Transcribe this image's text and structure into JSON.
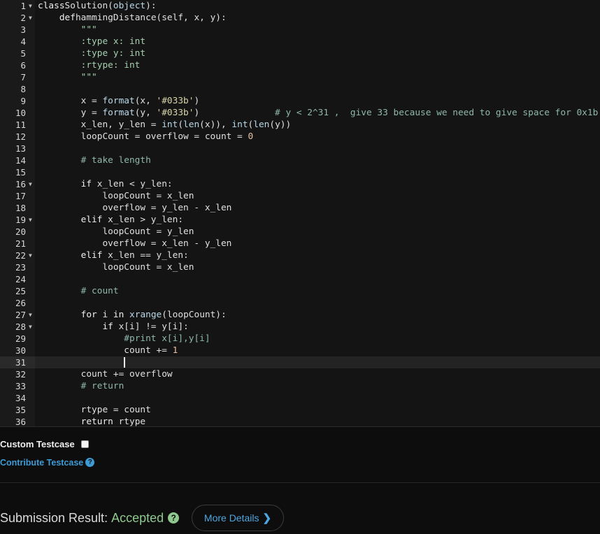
{
  "editor": {
    "active_line": 31,
    "lines": [
      {
        "n": "1",
        "fold": true,
        "tokens": [
          [
            "kw",
            "class"
          ],
          [
            "",
            "Solution("
          ],
          [
            "bi",
            "object"
          ],
          [
            "",
            "):"
          ]
        ]
      },
      {
        "n": "2",
        "fold": true,
        "tokens": [
          [
            "",
            "    "
          ],
          [
            "kw",
            "def"
          ],
          [
            "",
            "hammingDistance(self, x, y):"
          ]
        ]
      },
      {
        "n": "3",
        "fold": false,
        "tokens": [
          [
            "",
            "        "
          ],
          [
            "doc",
            "\"\"\""
          ]
        ]
      },
      {
        "n": "4",
        "fold": false,
        "tokens": [
          [
            "",
            "        "
          ],
          [
            "doc",
            ":type x: int"
          ]
        ]
      },
      {
        "n": "5",
        "fold": false,
        "tokens": [
          [
            "",
            "        "
          ],
          [
            "doc",
            ":type y: int"
          ]
        ]
      },
      {
        "n": "6",
        "fold": false,
        "tokens": [
          [
            "",
            "        "
          ],
          [
            "doc",
            ":rtype: int"
          ]
        ]
      },
      {
        "n": "7",
        "fold": false,
        "tokens": [
          [
            "",
            "        "
          ],
          [
            "doc",
            "\"\"\""
          ]
        ]
      },
      {
        "n": "8",
        "fold": false,
        "tokens": []
      },
      {
        "n": "9",
        "fold": false,
        "tokens": [
          [
            "",
            "        x = "
          ],
          [
            "bi",
            "format"
          ],
          [
            "",
            "(x, "
          ],
          [
            "str",
            "'#033b'"
          ],
          [
            "",
            ")"
          ]
        ]
      },
      {
        "n": "10",
        "fold": false,
        "tokens": [
          [
            "",
            "        y = "
          ],
          [
            "bi",
            "format"
          ],
          [
            "",
            "(y, "
          ],
          [
            "str",
            "'#033b'"
          ],
          [
            "",
            ")              "
          ],
          [
            "cm",
            "# y < 2^31 ,  give 33 because we need to give space for 0x1b"
          ]
        ]
      },
      {
        "n": "11",
        "fold": false,
        "tokens": [
          [
            "",
            "        x_len, y_len = "
          ],
          [
            "bi",
            "int"
          ],
          [
            "",
            "("
          ],
          [
            "bi",
            "len"
          ],
          [
            "",
            "(x)), "
          ],
          [
            "bi",
            "int"
          ],
          [
            "",
            "("
          ],
          [
            "bi",
            "len"
          ],
          [
            "",
            "(y))"
          ]
        ]
      },
      {
        "n": "12",
        "fold": false,
        "tokens": [
          [
            "",
            "        loopCount = overflow = count = "
          ],
          [
            "num",
            "0"
          ]
        ]
      },
      {
        "n": "13",
        "fold": false,
        "tokens": []
      },
      {
        "n": "14",
        "fold": false,
        "tokens": [
          [
            "",
            "        "
          ],
          [
            "cm",
            "# take length"
          ]
        ]
      },
      {
        "n": "15",
        "fold": false,
        "tokens": []
      },
      {
        "n": "16",
        "fold": true,
        "tokens": [
          [
            "",
            "        "
          ],
          [
            "kw",
            "if"
          ],
          [
            "",
            " x_len < y_len:"
          ]
        ]
      },
      {
        "n": "17",
        "fold": false,
        "tokens": [
          [
            "",
            "            loopCount = x_len"
          ]
        ]
      },
      {
        "n": "18",
        "fold": false,
        "tokens": [
          [
            "",
            "            overflow = y_len - x_len"
          ]
        ]
      },
      {
        "n": "19",
        "fold": true,
        "tokens": [
          [
            "",
            "        "
          ],
          [
            "kw",
            "elif"
          ],
          [
            "",
            " x_len > y_len:"
          ]
        ]
      },
      {
        "n": "20",
        "fold": false,
        "tokens": [
          [
            "",
            "            loopCount = y_len"
          ]
        ]
      },
      {
        "n": "21",
        "fold": false,
        "tokens": [
          [
            "",
            "            overflow = x_len - y_len"
          ]
        ]
      },
      {
        "n": "22",
        "fold": true,
        "tokens": [
          [
            "",
            "        "
          ],
          [
            "kw",
            "elif"
          ],
          [
            "",
            " x_len == y_len:"
          ]
        ]
      },
      {
        "n": "23",
        "fold": false,
        "tokens": [
          [
            "",
            "            loopCount = x_len"
          ]
        ]
      },
      {
        "n": "24",
        "fold": false,
        "tokens": []
      },
      {
        "n": "25",
        "fold": false,
        "tokens": [
          [
            "",
            "        "
          ],
          [
            "cm",
            "# count"
          ]
        ]
      },
      {
        "n": "26",
        "fold": false,
        "tokens": []
      },
      {
        "n": "27",
        "fold": true,
        "tokens": [
          [
            "",
            "        "
          ],
          [
            "kw",
            "for"
          ],
          [
            "",
            " i "
          ],
          [
            "kw",
            "in"
          ],
          [
            "",
            " "
          ],
          [
            "bi",
            "xrange"
          ],
          [
            "",
            "(loopCount):"
          ]
        ]
      },
      {
        "n": "28",
        "fold": true,
        "tokens": [
          [
            "",
            "            "
          ],
          [
            "kw",
            "if"
          ],
          [
            "",
            " x[i] != y[i]:"
          ]
        ]
      },
      {
        "n": "29",
        "fold": false,
        "tokens": [
          [
            "",
            "                "
          ],
          [
            "cm",
            "#print x[i],y[i]"
          ]
        ]
      },
      {
        "n": "30",
        "fold": false,
        "tokens": [
          [
            "",
            "                count += "
          ],
          [
            "num",
            "1"
          ]
        ]
      },
      {
        "n": "31",
        "fold": false,
        "tokens": []
      },
      {
        "n": "32",
        "fold": false,
        "tokens": [
          [
            "",
            "        count += overflow"
          ]
        ]
      },
      {
        "n": "33",
        "fold": false,
        "tokens": [
          [
            "",
            "        "
          ],
          [
            "cm",
            "# return"
          ]
        ]
      },
      {
        "n": "34",
        "fold": false,
        "tokens": []
      },
      {
        "n": "35",
        "fold": false,
        "tokens": [
          [
            "",
            "        rtype = count"
          ]
        ]
      },
      {
        "n": "36",
        "fold": false,
        "tokens": [
          [
            "",
            "        "
          ],
          [
            "kw",
            "return"
          ],
          [
            "",
            " rtype"
          ]
        ]
      }
    ]
  },
  "testcase": {
    "custom_label": "Custom Testcase",
    "custom_checked": false,
    "contribute_label": "Contribute Testcase",
    "help_icon": "question-circle-icon"
  },
  "submission": {
    "label": "Submission Result:",
    "status": "Accepted",
    "status_color": "#8ec88e",
    "help_icon": "question-circle-icon",
    "details_label": "More Details",
    "details_icon": "chevron-right-icon"
  },
  "colors": {
    "background": "#0d0d0d",
    "editor_bg": "#141414",
    "link": "#3d9bd6"
  }
}
